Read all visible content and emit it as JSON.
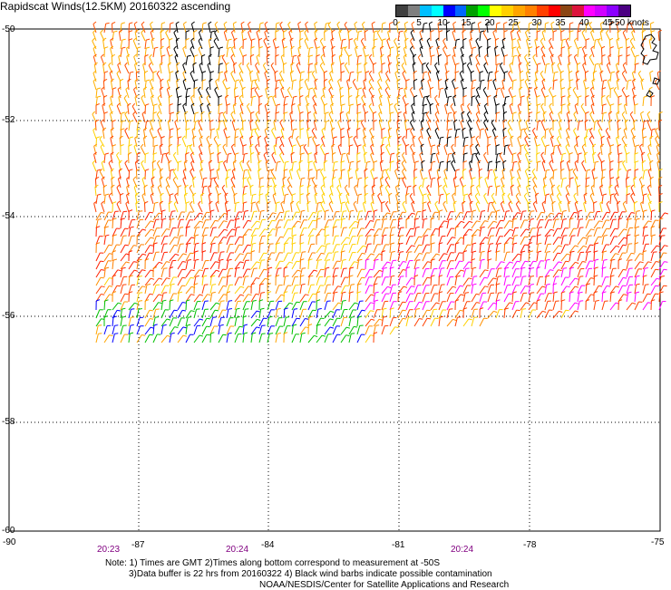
{
  "title": "Rapidscat Winds(12.5KM) 20160322 ascending",
  "legend": {
    "colors": [
      "#404040",
      "#7f7f7f",
      "#00bfff",
      "#00ffff",
      "#0000ff",
      "#0066ff",
      "#00a000",
      "#00ff00",
      "#ffff00",
      "#ffd000",
      "#ffa500",
      "#ff8000",
      "#ff4000",
      "#ff0000",
      "#8b4513",
      "#dc143c",
      "#ff00ff",
      "#d000ff",
      "#8b00ff",
      "#4b0082"
    ],
    "ticks": [
      "0",
      "5",
      "10",
      "15",
      "20",
      "25",
      "30",
      "35",
      "40",
      "45",
      ">50 knots"
    ]
  },
  "map": {
    "lat_labels": [
      "-50",
      "-52",
      "-54",
      "-56",
      "-58",
      "-60"
    ],
    "lon_labels": [
      "-90",
      "-87",
      "-84",
      "-81",
      "-78",
      "-75"
    ],
    "time_labels": [
      "20:23",
      "20:24",
      "20:24"
    ],
    "coastline": "visible-top-right"
  },
  "notes": {
    "line1": "Note: 1) Times are GMT 2)Times along bottom correspond to measurement at -50S",
    "line2": "3)Data buffer is 22 hrs from 20160322 4) Black wind barbs indicate possible contamination",
    "credit": "NOAA/NESDIS/Center for Satellite Applications and Research"
  }
}
